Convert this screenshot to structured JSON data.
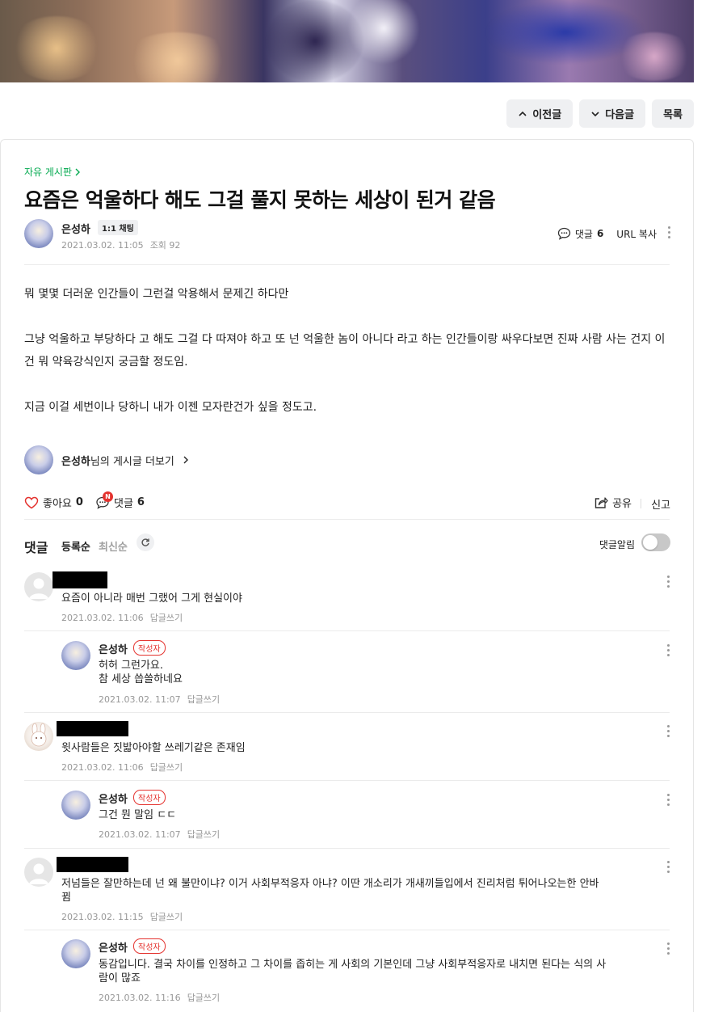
{
  "nav": {
    "prev": "이전글",
    "next": "다음글",
    "list": "목록"
  },
  "board": {
    "name": "자유 게시판"
  },
  "post": {
    "title": "요즘은 억울하다 해도 그걸 풀지 못하는 세상이 된거 같음",
    "author": "은성하",
    "chat_badge": "1:1 채팅",
    "date": "2021.03.02. 11:05",
    "views_label": "조회 92",
    "comment_label": "댓글",
    "comment_count": "6",
    "url_copy": "URL 복사",
    "paragraphs": [
      "뭐 몇몇 더러운 인간들이 그런걸 악용해서 문제긴 하다만",
      "그냥 억울하고 부당하다 고 해도 그걸 다 따져야 하고 또 넌 억울한 놈이 아니다 라고 하는 인간들이랑 싸우다보면 진짜 사람 사는 건지 이건 뭐 약육강식인지 궁금할 정도임.",
      "지금 이걸 세번이나 당하니 내가 이젠 모자란건가 싶을 정도고."
    ]
  },
  "more_posts": {
    "name": "은성하",
    "suffix": "님의 게시글 더보기"
  },
  "actions": {
    "like_label": "좋아요",
    "like_count": "0",
    "comment_label": "댓글",
    "comment_count": "6",
    "new_badge": "N",
    "share": "공유",
    "report": "신고"
  },
  "comments_section": {
    "title": "댓글",
    "sort_registered": "등록순",
    "sort_latest": "최신순",
    "alert_label": "댓글알림"
  },
  "comments": [
    {
      "name": "",
      "text": "요즘이 아니라 매번 그랬어 그게 현실이야",
      "date": "2021.03.02. 11:06",
      "reply": "답글쓰기"
    },
    {
      "name": "은성하",
      "tag": "작성자",
      "text": "허허 그런가요.\n참 세상 씁쓸하네요",
      "date": "2021.03.02. 11:07",
      "reply": "답글쓰기"
    },
    {
      "name": "",
      "text": "윗사람들은 짓밟아야할 쓰레기같은 존재임",
      "date": "2021.03.02. 11:06",
      "reply": "답글쓰기"
    },
    {
      "name": "은성하",
      "tag": "작성자",
      "text": "그건 뭔 말임 ㄷㄷ",
      "date": "2021.03.02. 11:07",
      "reply": "답글쓰기"
    },
    {
      "name": "",
      "text": "저넘들은 잘만하는데 넌 왜 불만이냐? 이거 사회부적응자 아냐? 이딴 개소리가 개새끼들입에서 진리처럼 튀어나오는한 안바\n뀜",
      "date": "2021.03.02. 11:15",
      "reply": "답글쓰기"
    },
    {
      "name": "은성하",
      "tag": "작성자",
      "text": "동감입니다. 결국 차이를 인정하고 그 차이를 좁히는 게 사회의 기본인데 그냥 사회부적응자로 내치면 된다는 식의 사\n람이 많죠",
      "date": "2021.03.02. 11:16",
      "reply": "답글쓰기"
    }
  ]
}
